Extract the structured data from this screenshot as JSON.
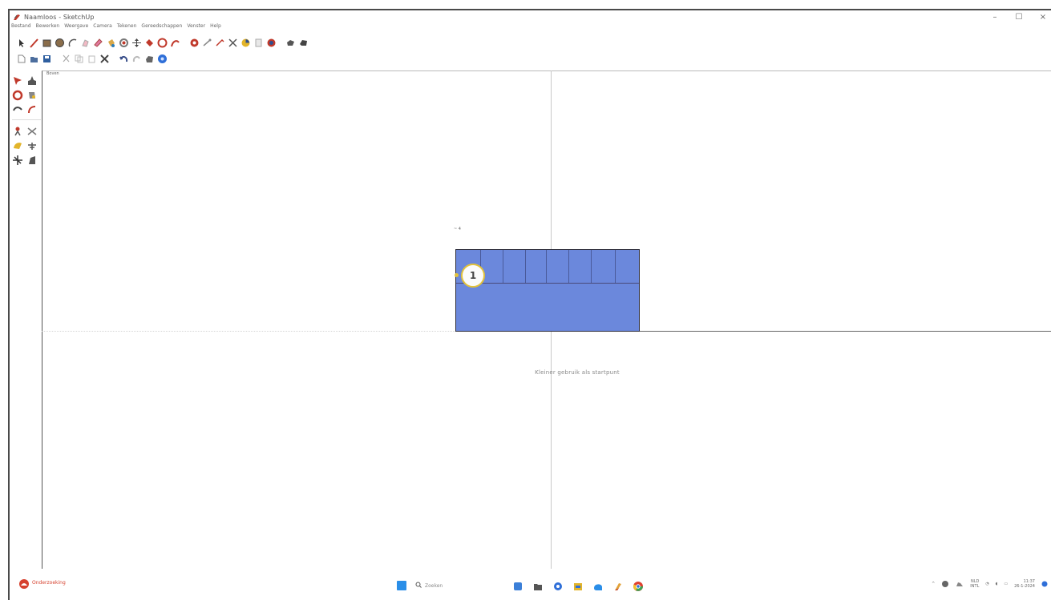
{
  "window": {
    "title": "Naamloos - SketchUp",
    "controls": {
      "minimize": "–",
      "maximize": "☐",
      "close": "×"
    }
  },
  "menu": [
    "Bestand",
    "Bewerken",
    "Weergave",
    "Camera",
    "Tekenen",
    "Gereedschappen",
    "Venster",
    "Help"
  ],
  "viewport": {
    "label": "Boven",
    "dimension_label": "~ 4",
    "callout_number": "1",
    "center_text": "Kleiner gebruik als startpunt"
  },
  "colors": {
    "model_fill": "#6b88dc",
    "callout_border": "#e2c23a",
    "accent_blue": "#2a8ee8"
  },
  "taskbar": {
    "status_label": "Onderzoeking",
    "search_placeholder": "Zoeken",
    "language": "NLD",
    "language_sub": "INTL",
    "time": "11:37",
    "date": "26-1-2024"
  }
}
